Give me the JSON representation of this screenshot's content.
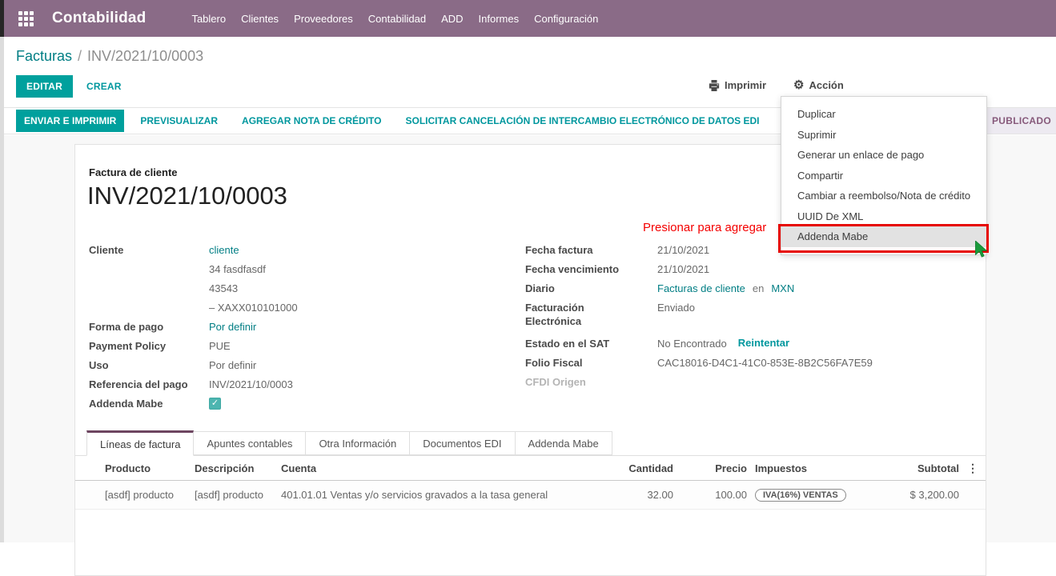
{
  "colors": {
    "brand_bar": "#8a6b87",
    "primary_teal": "#00a09d",
    "link_teal": "#017e84",
    "status_purple": "#875a7b",
    "annotation_red": "#f40000",
    "highlight_border_red": "#e60400",
    "cursor_green": "#1a9a3c"
  },
  "icons": {
    "apps": "grid-3x3",
    "print": "printer",
    "action": "gear",
    "gear_glyph": "⚙",
    "row_options": "⋮",
    "check": "✓"
  },
  "topbar": {
    "app_title": "Contabilidad",
    "menu": [
      "Tablero",
      "Clientes",
      "Proveedores",
      "Contabilidad",
      "ADD",
      "Informes",
      "Configuración"
    ]
  },
  "breadcrumb": {
    "parent": "Facturas",
    "separator": "/",
    "current": "INV/2021/10/0003"
  },
  "actions": {
    "edit": "EDITAR",
    "create": "CREAR",
    "print": "Imprimir",
    "action": "Acción"
  },
  "statusbar": {
    "buttons": [
      {
        "label": "ENVIAR E IMPRIMIR",
        "class": "sb-primary"
      },
      {
        "label": "PREVISUALIZAR",
        "class": "sb-link"
      },
      {
        "label": "AGREGAR NOTA DE CRÉDITO",
        "class": "sb-link"
      },
      {
        "label": "SOLICITAR CANCELACIÓN DE INTERCAMBIO ELECTRÓNICO DE DATOS EDI",
        "class": "sb-link"
      }
    ],
    "status": "PUBLICADO"
  },
  "action_menu": {
    "items": [
      {
        "label": "Duplicar"
      },
      {
        "label": "Suprimir"
      },
      {
        "label": "Generar un enlace de pago"
      },
      {
        "label": "Compartir"
      },
      {
        "label": "Cambiar a reembolso/Nota de crédito"
      },
      {
        "label": "UUID De XML"
      },
      {
        "label": "Addenda Mabe",
        "class": "highlighted"
      }
    ]
  },
  "annotation": {
    "text": "Presionar para agregar"
  },
  "invoice": {
    "doc_type": "Factura de cliente",
    "number": "INV/2021/10/0003",
    "cliente": {
      "label": "Cliente",
      "name": "cliente",
      "address": [
        "34 fasdfasdf",
        "43543",
        "– XAXX010101000"
      ]
    },
    "forma_de_pago": {
      "label": "Forma de pago",
      "value": "Por definir"
    },
    "payment_policy": {
      "label": "Payment Policy",
      "value": "PUE"
    },
    "uso": {
      "label": "Uso",
      "value": "Por definir"
    },
    "referencia": {
      "label": "Referencia del pago",
      "value": "INV/2021/10/0003"
    },
    "addenda": {
      "label": "Addenda Mabe",
      "checked": true
    },
    "fecha_factura": {
      "label": "Fecha factura",
      "value": "21/10/2021"
    },
    "fecha_vencimiento": {
      "label": "Fecha vencimiento",
      "value": "21/10/2021"
    },
    "diario": {
      "label": "Diario",
      "journal": "Facturas de cliente",
      "conjunction": "en",
      "currency": "MXN"
    },
    "facturacion_electronica": {
      "label": "Facturación Electrónica",
      "value": "Enviado"
    },
    "estado_sat": {
      "label": "Estado en el SAT",
      "value": "No Encontrado",
      "action": "Reintentar"
    },
    "folio_fiscal": {
      "label": "Folio Fiscal",
      "value": "CAC18016-D4C1-41C0-853E-8B2C56FA7E59"
    },
    "cfdi_origen": {
      "label": "CFDI Origen",
      "value": ""
    }
  },
  "tabs": [
    {
      "label": "Líneas de factura",
      "class": "active"
    },
    {
      "label": "Apuntes contables"
    },
    {
      "label": "Otra Información"
    },
    {
      "label": "Documentos EDI"
    },
    {
      "label": "Addenda Mabe"
    }
  ],
  "lines_table": {
    "headers": {
      "producto": "Producto",
      "descripcion": "Descripción",
      "cuenta": "Cuenta",
      "cantidad": "Cantidad",
      "precio": "Precio",
      "impuestos": "Impuestos",
      "subtotal": "Subtotal"
    },
    "rows": [
      {
        "producto": "[asdf] producto",
        "descripcion": "[asdf] producto",
        "cuenta": "401.01.01 Ventas y/o servicios gravados a la tasa general",
        "cantidad": "32.00",
        "precio": "100.00",
        "impuestos": "IVA(16%) VENTAS",
        "subtotal": "$ 3,200.00"
      }
    ]
  }
}
